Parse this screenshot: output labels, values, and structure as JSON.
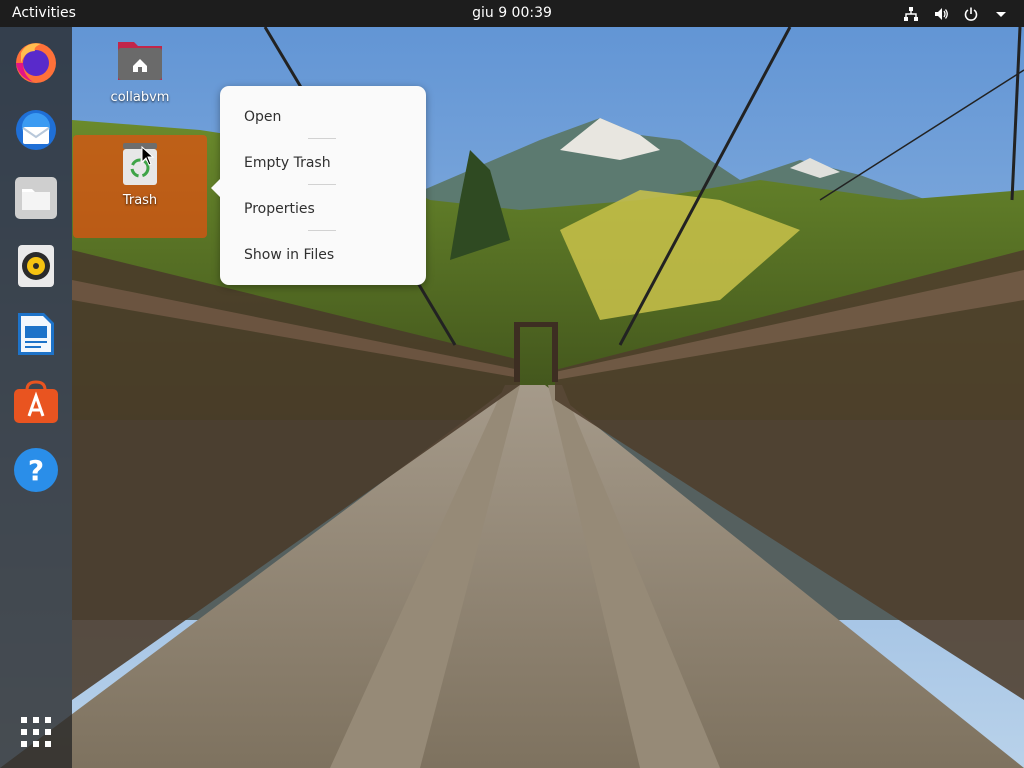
{
  "topbar": {
    "activities_label": "Activities",
    "clock": "giu 9  00:39",
    "tray_icons": [
      "network-icon",
      "volume-icon",
      "power-icon",
      "menu-caret-icon"
    ]
  },
  "dock": {
    "items": [
      {
        "name": "firefox",
        "icon": "firefox-icon"
      },
      {
        "name": "thunderbird",
        "icon": "thunderbird-icon"
      },
      {
        "name": "files",
        "icon": "files-icon"
      },
      {
        "name": "rhythmbox",
        "icon": "rhythmbox-icon"
      },
      {
        "name": "libreoffice-writer",
        "icon": "writer-icon"
      },
      {
        "name": "ubuntu-software",
        "icon": "software-icon"
      },
      {
        "name": "help",
        "icon": "help-icon"
      }
    ],
    "show_apps_icon": "app-grid-icon"
  },
  "desktop": {
    "icons": [
      {
        "label": "collabvm",
        "icon": "home-folder-icon"
      },
      {
        "label": "Trash",
        "icon": "trash-icon"
      }
    ]
  },
  "context_menu": {
    "items": [
      "Open",
      "Empty Trash",
      "Properties",
      "Show in Files"
    ]
  },
  "colors": {
    "topbar": "#1d1d1d",
    "selection": "#e05211",
    "menu_bg": "#fafafa"
  }
}
